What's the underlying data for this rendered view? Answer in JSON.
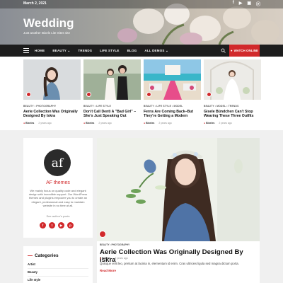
{
  "header": {
    "date": "March 2, 2021",
    "socials": [
      "f",
      "▶",
      "▣",
      "ⓟ"
    ],
    "title": "Wedding",
    "tagline": "Just another Bixels Lite Sites site"
  },
  "nav": {
    "items": [
      "HOME",
      "BEAUTY ⌄",
      "TRENDS",
      "LIFE STYLE",
      "BLOG",
      "ALL DEMOS ⌄"
    ],
    "watch_label": "WATCH ONLINE",
    "accent": "#d1292b"
  },
  "posts": [
    {
      "cat": "BEAUTY • PHOTOGRAPHY",
      "title": "Aerie Collection Was Originally Designed By Iskra",
      "author": "Bixeles",
      "time": "2 years ago"
    },
    {
      "cat": "BEAUTY • LIFE STYLE",
      "title": "Don't Call Denti A \"Bad Girl\" – She's Just Speaking Out",
      "author": "Bixeles",
      "time": "2 years ago"
    },
    {
      "cat": "BEAUTY • LIFE STYLE • MODEL",
      "title": "Ferns Are Coming Back–But They're Getting a Modern",
      "author": "Bixeles",
      "time": "2 years ago"
    },
    {
      "cat": "BEAUTY • MODEL • TRENDS",
      "title": "Gisele Bündchen Can't Stop Wearing These Three Outfits",
      "author": "Bixeles",
      "time": "2 years ago"
    }
  ],
  "sidebar": {
    "logo_text": "af",
    "name": "AF themes",
    "description": "We mainly focus on quality code and elegant design with incredible support. Our WordPress themes and plugins empower you to create an elegant, professional and easy to maintain website in no time at all.",
    "link": "See author's posts",
    "social": [
      "f",
      "t",
      "▶",
      "p"
    ],
    "categories_title": "Categories",
    "categories": [
      "Artist",
      "Beauty",
      "Life style"
    ]
  },
  "featured": {
    "cat": "BEAUTY • PHOTOGRAPHY",
    "title": "Aerie Collection Was Originally Designed By Iskra",
    "author": "Bixeles",
    "time": "2 years ago",
    "excerpt": "Quisque velit leo, pretium at lacinia in, elementum id enim. Cras ultricies ligula sed magna dictum porta.",
    "more": "Read More"
  }
}
